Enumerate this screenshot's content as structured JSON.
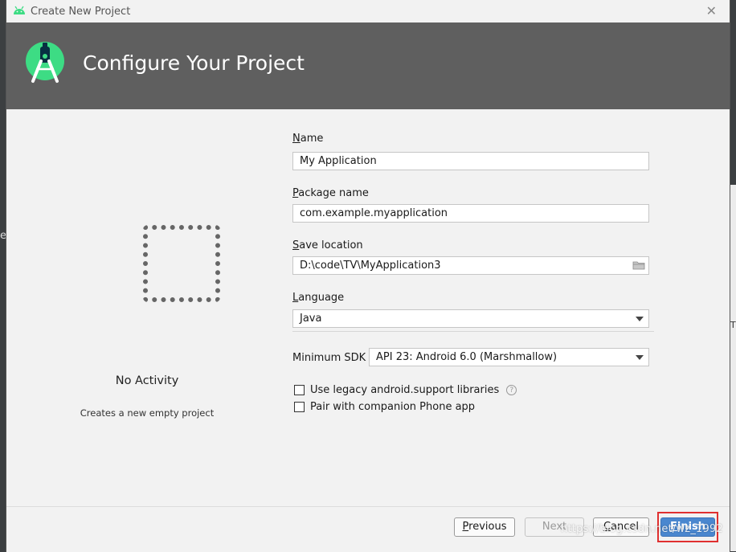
{
  "window": {
    "title": "Create New Project"
  },
  "header": {
    "title": "Configure Your Project"
  },
  "template": {
    "name": "No Activity",
    "description": "Creates a new empty project"
  },
  "form": {
    "name": {
      "label_first": "N",
      "label_rest": "ame",
      "value": "My Application"
    },
    "package": {
      "label_first": "P",
      "label_rest": "ackage name",
      "value": "com.example.myapplication"
    },
    "location": {
      "label_first": "S",
      "label_rest": "ave location",
      "value": "D:\\code\\TV\\MyApplication3"
    },
    "language": {
      "label_first": "L",
      "label_rest": "anguage",
      "value": "Java"
    },
    "min_sdk": {
      "label": "Minimum SDK",
      "value": "API 23: Android 6.0 (Marshmallow)"
    },
    "legacy_support": {
      "label": "Use legacy android.support libraries",
      "checked": false
    },
    "companion": {
      "label": "Pair with companion Phone app",
      "checked": false
    }
  },
  "buttons": {
    "previous_first": "P",
    "previous_rest": "revious",
    "next": "Next",
    "cancel_first": "C",
    "cancel_rest": "ancel",
    "finish_first": "F",
    "finish_rest": "inish"
  },
  "watermark": "https://blog.csdn.net/wz_1992",
  "colors": {
    "header_bg": "#5f5f5f",
    "android_green": "#3ddc84",
    "finish_blue": "#4a87cf",
    "highlight_red": "#e03030"
  },
  "background": {
    "left_letter": "e",
    "right_letter": "T"
  }
}
